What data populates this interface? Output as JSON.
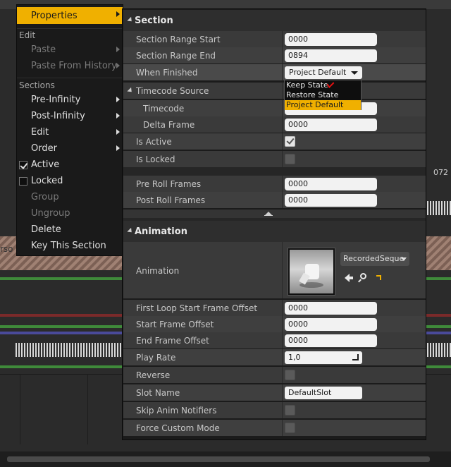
{
  "background": {
    "timeline_label": "072",
    "partial_label": "rso"
  },
  "context_menu": {
    "properties_label": "Properties",
    "edit_header": "Edit",
    "edit_items": [
      {
        "label": "Paste",
        "enabled": false,
        "submenu": true
      },
      {
        "label": "Paste From History",
        "enabled": false,
        "submenu": true
      }
    ],
    "sections_header": "Sections",
    "section_items": [
      {
        "label": "Pre-Infinity",
        "enabled": true,
        "submenu": true
      },
      {
        "label": "Post-Infinity",
        "enabled": true,
        "submenu": true
      },
      {
        "label": "Edit",
        "enabled": true,
        "submenu": true
      },
      {
        "label": "Order",
        "enabled": true,
        "submenu": true
      }
    ],
    "active_label": "Active",
    "active_checked": true,
    "locked_label": "Locked",
    "locked_checked": false,
    "group_label": "Group",
    "ungroup_label": "Ungroup",
    "delete_label": "Delete",
    "key_this_section_label": "Key This Section"
  },
  "details": {
    "section": {
      "title": "Section",
      "range_start_label": "Section Range Start",
      "range_start_value": "0000",
      "range_end_label": "Section Range End",
      "range_end_value": "0894",
      "when_finished_label": "When Finished",
      "when_finished_value": "Project Default",
      "when_finished_options": [
        "Keep State",
        "Restore State",
        "Project Default"
      ],
      "timecode_source_label": "Timecode Source",
      "timecode_label": "Timecode",
      "timecode_value": "",
      "delta_frame_label": "Delta Frame",
      "delta_frame_value": "0000",
      "is_active_label": "Is Active",
      "is_active": true,
      "is_locked_label": "Is Locked",
      "is_locked": false,
      "pre_roll_label": "Pre Roll Frames",
      "pre_roll_value": "0000",
      "post_roll_label": "Post Roll Frames",
      "post_roll_value": "0000"
    },
    "animation": {
      "title": "Animation",
      "animation_label": "Animation",
      "asset_name": "RecordedSeque",
      "first_loop_label": "First Loop Start Frame Offset",
      "first_loop_value": "0000",
      "start_offset_label": "Start Frame Offset",
      "start_offset_value": "0000",
      "end_offset_label": "End Frame Offset",
      "end_offset_value": "0000",
      "play_rate_label": "Play Rate",
      "play_rate_value": "1,0",
      "reverse_label": "Reverse",
      "reverse": false,
      "slot_name_label": "Slot Name",
      "slot_name_value": "DefaultSlot",
      "skip_notifiers_label": "Skip Anim Notifiers",
      "skip_notifiers": false,
      "force_custom_label": "Force Custom Mode",
      "force_custom": false
    }
  },
  "colors": {
    "accent": "#f0b000",
    "panel_bg": "#1b1b1b",
    "row_bg": "#3a3a3a",
    "annotation": "#e01010"
  }
}
